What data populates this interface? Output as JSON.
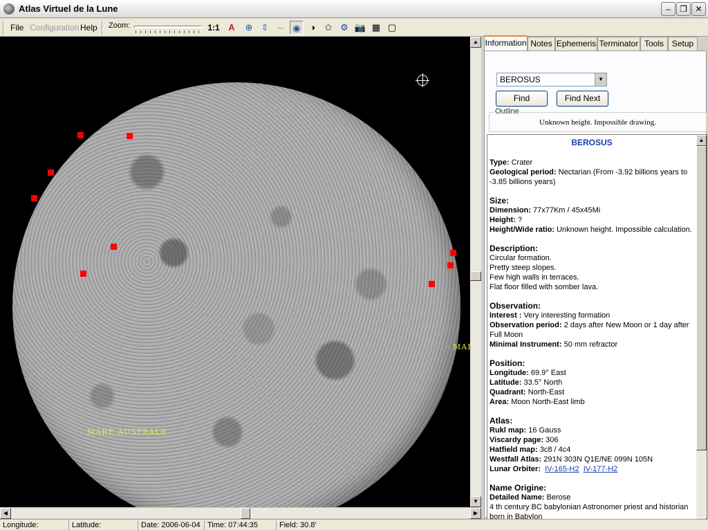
{
  "window": {
    "title": "Atlas Virtuel de la Lune"
  },
  "menu": {
    "file": "File",
    "configuration": "Configuration",
    "help": "Help"
  },
  "toolbar": {
    "zoom_label": "Zoom:",
    "zoom_reset": "1:1"
  },
  "map": {
    "labels": [
      {
        "text": "MARE AUSTRALE"
      },
      {
        "text": "· MAR"
      }
    ]
  },
  "tabs": [
    "Information",
    "Notes",
    "Ephemeris",
    "Terminator",
    "Tools",
    "Setup"
  ],
  "search": {
    "selected": "BEROSUS",
    "find": "Find",
    "find_next": "Find Next"
  },
  "outline": {
    "legend": "Outline",
    "text": "Unknown height. Impossible drawing."
  },
  "info": {
    "name": "BEROSUS",
    "type_label": "Type:",
    "type": "Crater",
    "geo_label": "Geological period:",
    "geo": "Nectarian (From -3.92 billions years to -3.85 billions years)",
    "size_header": "Size:",
    "dimension_label": "Dimension:",
    "dimension": "77x77Km / 45x45Mi",
    "height_label": "Height:",
    "height": "?",
    "ratio_label": "Height/Wide ratio:",
    "ratio": "Unknown height. Impossible calculation.",
    "desc_header": "Description:",
    "desc": [
      "Circular formation.",
      "Pretty steep slopes.",
      "Few high walls in terraces.",
      "Flat floor filled with somber lava."
    ],
    "obs_header": "Observation:",
    "interest_label": "Interest :",
    "interest": "Very interesting formation",
    "obs_period_label": "Observation period:",
    "obs_period": "2 days after New Moon or 1 day after Full Moon",
    "instrument_label": "Minimal Instrument:",
    "instrument": "50 mm refractor",
    "pos_header": "Position:",
    "longitude_label": "Longitude:",
    "longitude": "69.9° East",
    "latitude_label": "Latitude:",
    "latitude": "33.5° North",
    "quadrant_label": "Quadrant:",
    "quadrant": "North-East",
    "area_label": "Area:",
    "area": "Moon North-East limb",
    "atlas_header": "Atlas:",
    "rukl_label": "Rukl map:",
    "rukl": "16 Gauss",
    "viscardy_label": "Viscardy page:",
    "viscardy": "306",
    "hatfield_label": "Hatfield map:",
    "hatfield": "3c8 / 4c4",
    "westfall_label": "Westfall Atlas:",
    "westfall": "291N 303N Q1E/NE 099N 105N",
    "orbiter_label": "Lunar Orbiter:",
    "orbiter_1": "IV-165-H2",
    "orbiter_2": "IV-177-H2",
    "origin_header": "Name Origine:",
    "detailed_label": "Detailed Name:",
    "detailed": "Berose",
    "origin_text": "4 th century BC babylonian Astronomer priest and historian born in Babylon"
  },
  "status": {
    "longitude": "Longitude:",
    "latitude": "Latitude:",
    "date": "Date: 2006-06-04",
    "time": "Time: 07:44:35",
    "field": "Field: 30.8'"
  },
  "colors": {
    "marker": "#ff0000",
    "label": "#e8e840",
    "title_blue": "#1a3da6",
    "tab_accent": "#e68b2c"
  }
}
